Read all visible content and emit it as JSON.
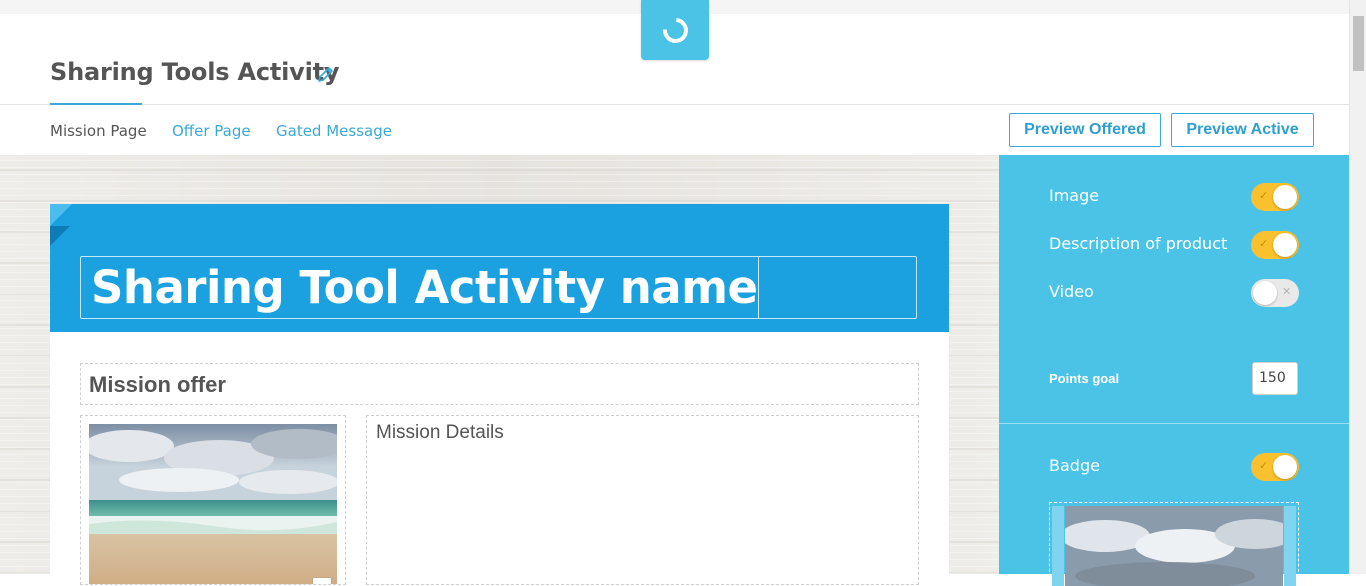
{
  "header": {
    "title": "Sharing Tools Activity",
    "edit_icon": "pencil-icon",
    "loader_icon": "spinner-icon"
  },
  "tabs": [
    {
      "label": "Mission Page",
      "active": true
    },
    {
      "label": "Offer Page",
      "active": false
    },
    {
      "label": "Gated Message",
      "active": false
    }
  ],
  "actions": {
    "preview_offered": "Preview Offered",
    "preview_active": "Preview Active"
  },
  "editor": {
    "activity_name": "Sharing Tool Activity name",
    "mission_offer": "Mission offer",
    "mission_details": "Mission Details",
    "image_tool_icon": "trash-icon"
  },
  "settings": {
    "options": [
      {
        "label": "Image",
        "enabled": true
      },
      {
        "label": "Description of product",
        "enabled": true
      },
      {
        "label": "Video",
        "enabled": false
      }
    ],
    "points_goal_label": "Points goal",
    "points_goal_value": "150",
    "badge": {
      "label": "Badge",
      "enabled": true
    }
  },
  "colors": {
    "accent": "#3aa8d8",
    "banner": "#1ca1e0",
    "sidebar": "#4bc3e7",
    "toggle_on": "#fbc02d"
  }
}
